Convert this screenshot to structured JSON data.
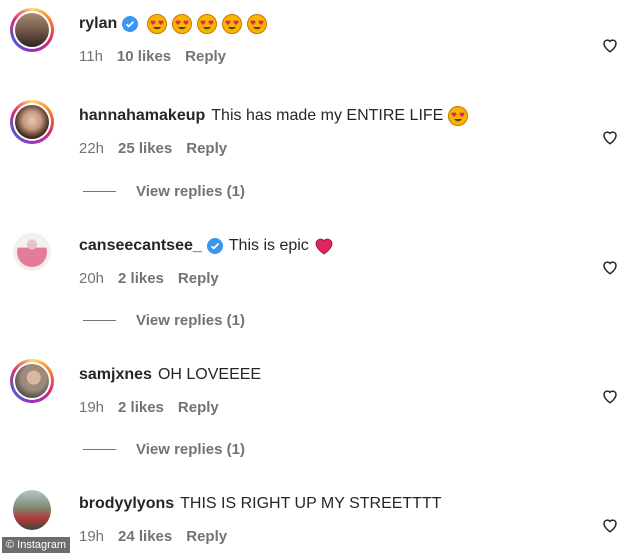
{
  "comments": [
    {
      "username": "rylan",
      "verified": true,
      "text": "",
      "emoji": [
        "heart-eyes",
        "heart-eyes",
        "heart-eyes",
        "heart-eyes",
        "heart-eyes"
      ],
      "time": "11h",
      "likes": "10 likes",
      "reply": "Reply"
    },
    {
      "username": "hannahamakeup",
      "verified": false,
      "text": "This has made my ENTIRE LIFE",
      "emoji": [
        "heart-eyes"
      ],
      "time": "22h",
      "likes": "25 likes",
      "reply": "Reply",
      "view_replies": "View replies (1)"
    },
    {
      "username": "canseecantsee_",
      "verified": true,
      "text": "This is epic",
      "emoji": [
        "red-heart"
      ],
      "time": "20h",
      "likes": "2 likes",
      "reply": "Reply",
      "view_replies": "View replies (1)"
    },
    {
      "username": "samjxnes",
      "verified": false,
      "text": "OH LOVEEEE",
      "emoji": [],
      "time": "19h",
      "likes": "2 likes",
      "reply": "Reply",
      "view_replies": "View replies (1)"
    },
    {
      "username": "brodyylyons",
      "verified": false,
      "text": "THIS IS RIGHT UP MY STREETTTT",
      "emoji": [],
      "time": "19h",
      "likes": "24 likes",
      "reply": "Reply"
    }
  ],
  "watermark": "© Instagram",
  "colors": {
    "text": "#262626",
    "meta": "#737373",
    "verified_blue": "#3897f0",
    "heart_red": "#e0245e"
  }
}
